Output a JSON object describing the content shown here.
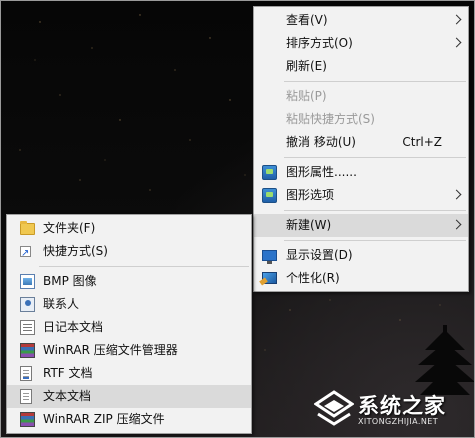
{
  "colors": {
    "menu_bg": "#f2f2f2",
    "menu_highlight": "#dadada",
    "disabled_text": "#9a9a9a",
    "desktop_bg": "#0a0a0a"
  },
  "context_menu": {
    "items": [
      {
        "label": "查看(V)",
        "submenu": true,
        "icon": null
      },
      {
        "label": "排序方式(O)",
        "submenu": true,
        "icon": null
      },
      {
        "label": "刷新(E)",
        "icon": null
      },
      {
        "label": "粘贴(P)",
        "disabled": true,
        "icon": null
      },
      {
        "label": "粘贴快捷方式(S)",
        "disabled": true,
        "icon": null
      },
      {
        "label": "撤消 移动(U)",
        "shortcut": "Ctrl+Z",
        "icon": null
      },
      {
        "label": "图形属性......",
        "icon": "graphics-properties-icon"
      },
      {
        "label": "图形选项",
        "submenu": true,
        "icon": "graphics-options-icon"
      },
      {
        "label": "新建(W)",
        "submenu": true,
        "highlighted": true,
        "icon": null
      },
      {
        "label": "显示设置(D)",
        "icon": "display-settings-icon"
      },
      {
        "label": "个性化(R)",
        "icon": "personalize-icon"
      }
    ]
  },
  "new_submenu": {
    "items": [
      {
        "label": "文件夹(F)",
        "icon": "folder-icon"
      },
      {
        "label": "快捷方式(S)",
        "icon": "shortcut-icon"
      },
      {
        "label": "BMP 图像",
        "icon": "bmp-image-icon"
      },
      {
        "label": "联系人",
        "icon": "contact-icon"
      },
      {
        "label": "日记本文档",
        "icon": "journal-icon"
      },
      {
        "label": "WinRAR 压缩文件管理器",
        "icon": "winrar-icon"
      },
      {
        "label": "RTF 文档",
        "icon": "rtf-document-icon"
      },
      {
        "label": "文本文档",
        "highlighted": true,
        "icon": "text-document-icon"
      },
      {
        "label": "WinRAR ZIP 压缩文件",
        "icon": "winrar-zip-icon"
      }
    ]
  },
  "watermark": {
    "title": "系统之家",
    "url": "XITONGZHIJIA.NET"
  }
}
